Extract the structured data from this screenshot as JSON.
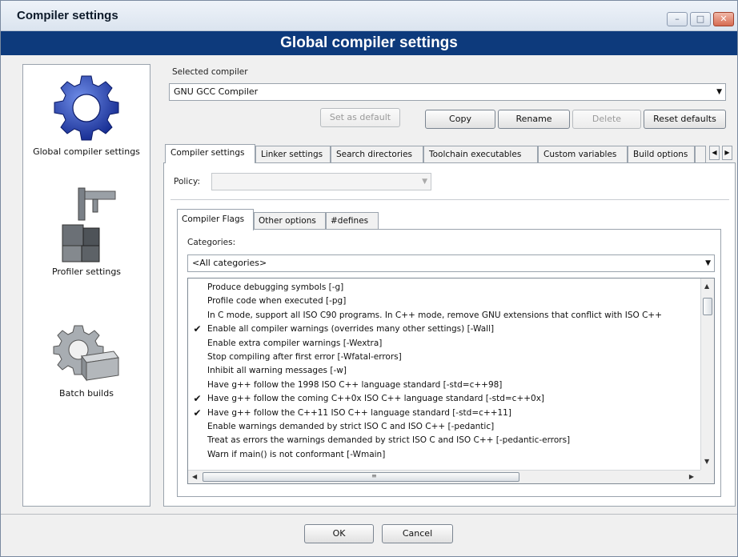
{
  "window": {
    "title": "Compiler settings",
    "controls": [
      "minimize",
      "maximize",
      "close"
    ]
  },
  "banner": "Global compiler settings",
  "sidebar": {
    "items": [
      {
        "label": "Global compiler settings",
        "icon": "gear-icon"
      },
      {
        "label": "Profiler settings",
        "icon": "caliper-icon"
      },
      {
        "label": "Batch builds",
        "icon": "gear-box-icon"
      }
    ]
  },
  "compiler": {
    "label": "Selected compiler",
    "value": "GNU GCC Compiler",
    "buttons": {
      "set_default": "Set as default",
      "copy": "Copy",
      "rename": "Rename",
      "delete": "Delete",
      "reset": "Reset defaults"
    }
  },
  "tabs": [
    "Compiler settings",
    "Linker settings",
    "Search directories",
    "Toolchain executables",
    "Custom variables",
    "Build options"
  ],
  "policy": {
    "label": "Policy:",
    "value": ""
  },
  "inner_tabs": [
    "Compiler Flags",
    "Other options",
    "#defines"
  ],
  "categories": {
    "label": "Categories:",
    "value": "<All categories>"
  },
  "flags": [
    {
      "checked": false,
      "text": "Produce debugging symbols  [-g]"
    },
    {
      "checked": false,
      "text": "Profile code when executed  [-pg]"
    },
    {
      "checked": false,
      "text": "In C mode, support all ISO C90 programs. In C++ mode, remove GNU extensions that conflict with ISO C++"
    },
    {
      "checked": true,
      "text": "Enable all compiler warnings (overrides many other settings)  [-Wall]"
    },
    {
      "checked": false,
      "text": "Enable extra compiler warnings  [-Wextra]"
    },
    {
      "checked": false,
      "text": "Stop compiling after first error  [-Wfatal-errors]"
    },
    {
      "checked": false,
      "text": "Inhibit all warning messages  [-w]"
    },
    {
      "checked": false,
      "text": "Have g++ follow the 1998 ISO C++ language standard  [-std=c++98]"
    },
    {
      "checked": true,
      "text": "Have g++ follow the coming C++0x ISO C++ language standard  [-std=c++0x]"
    },
    {
      "checked": true,
      "text": "Have g++ follow the C++11 ISO C++ language standard  [-std=c++11]"
    },
    {
      "checked": false,
      "text": "Enable warnings demanded by strict ISO C and ISO C++  [-pedantic]"
    },
    {
      "checked": false,
      "text": "Treat as errors the warnings demanded by strict ISO C and ISO C++  [-pedantic-errors]"
    },
    {
      "checked": false,
      "text": "Warn if main() is not conformant  [-Wmain]"
    }
  ],
  "footer": {
    "ok": "OK",
    "cancel": "Cancel"
  }
}
